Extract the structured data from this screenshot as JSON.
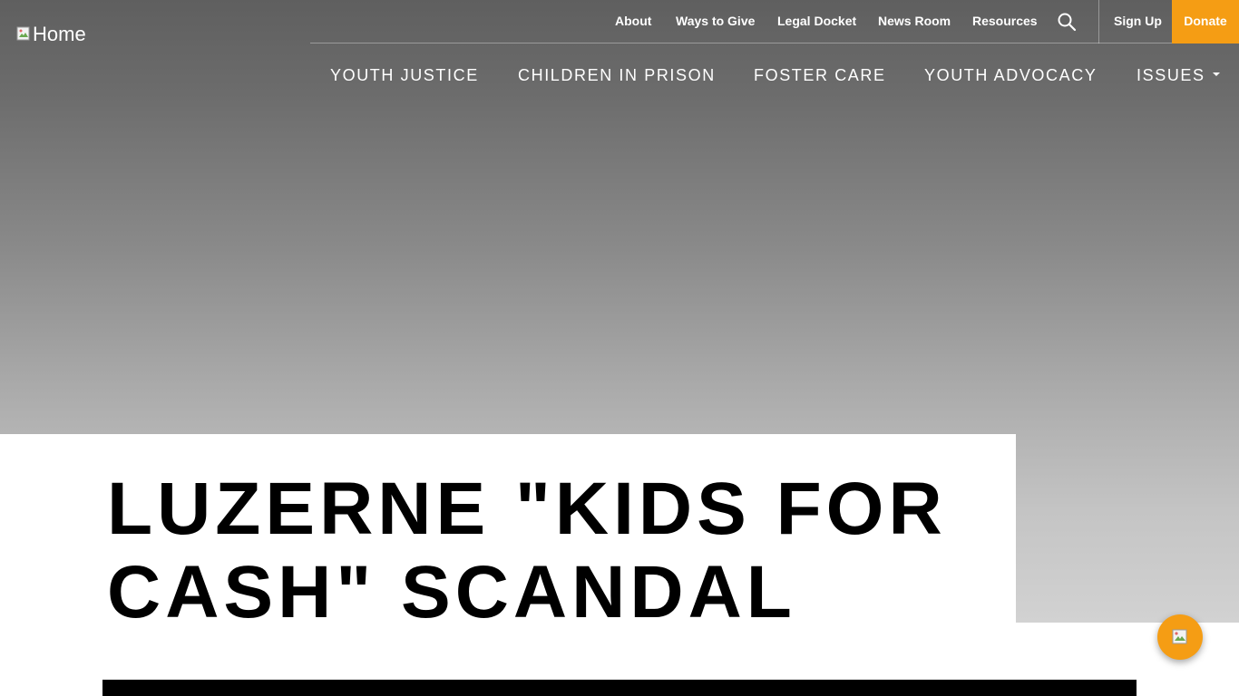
{
  "logo": {
    "alt_text": "Home"
  },
  "utility_nav": {
    "links": [
      "About",
      "Ways to Give",
      "Legal Docket",
      "News Room",
      "Resources"
    ],
    "search_icon": "search-icon",
    "signup_label": "Sign Up",
    "donate_label": "Donate"
  },
  "main_nav": {
    "items": [
      "YOUTH JUSTICE",
      "CHILDREN IN PRISON",
      "FOSTER CARE",
      "YOUTH ADVOCACY",
      "ISSUES"
    ]
  },
  "page": {
    "title": "LUZERNE \"KIDS FOR CASH\" SCANDAL"
  },
  "chat_widget": {
    "icon": "chat-icon"
  },
  "colors": {
    "accent": "#f59d14",
    "text_dark": "#000000",
    "nav_text": "#ffffff"
  }
}
